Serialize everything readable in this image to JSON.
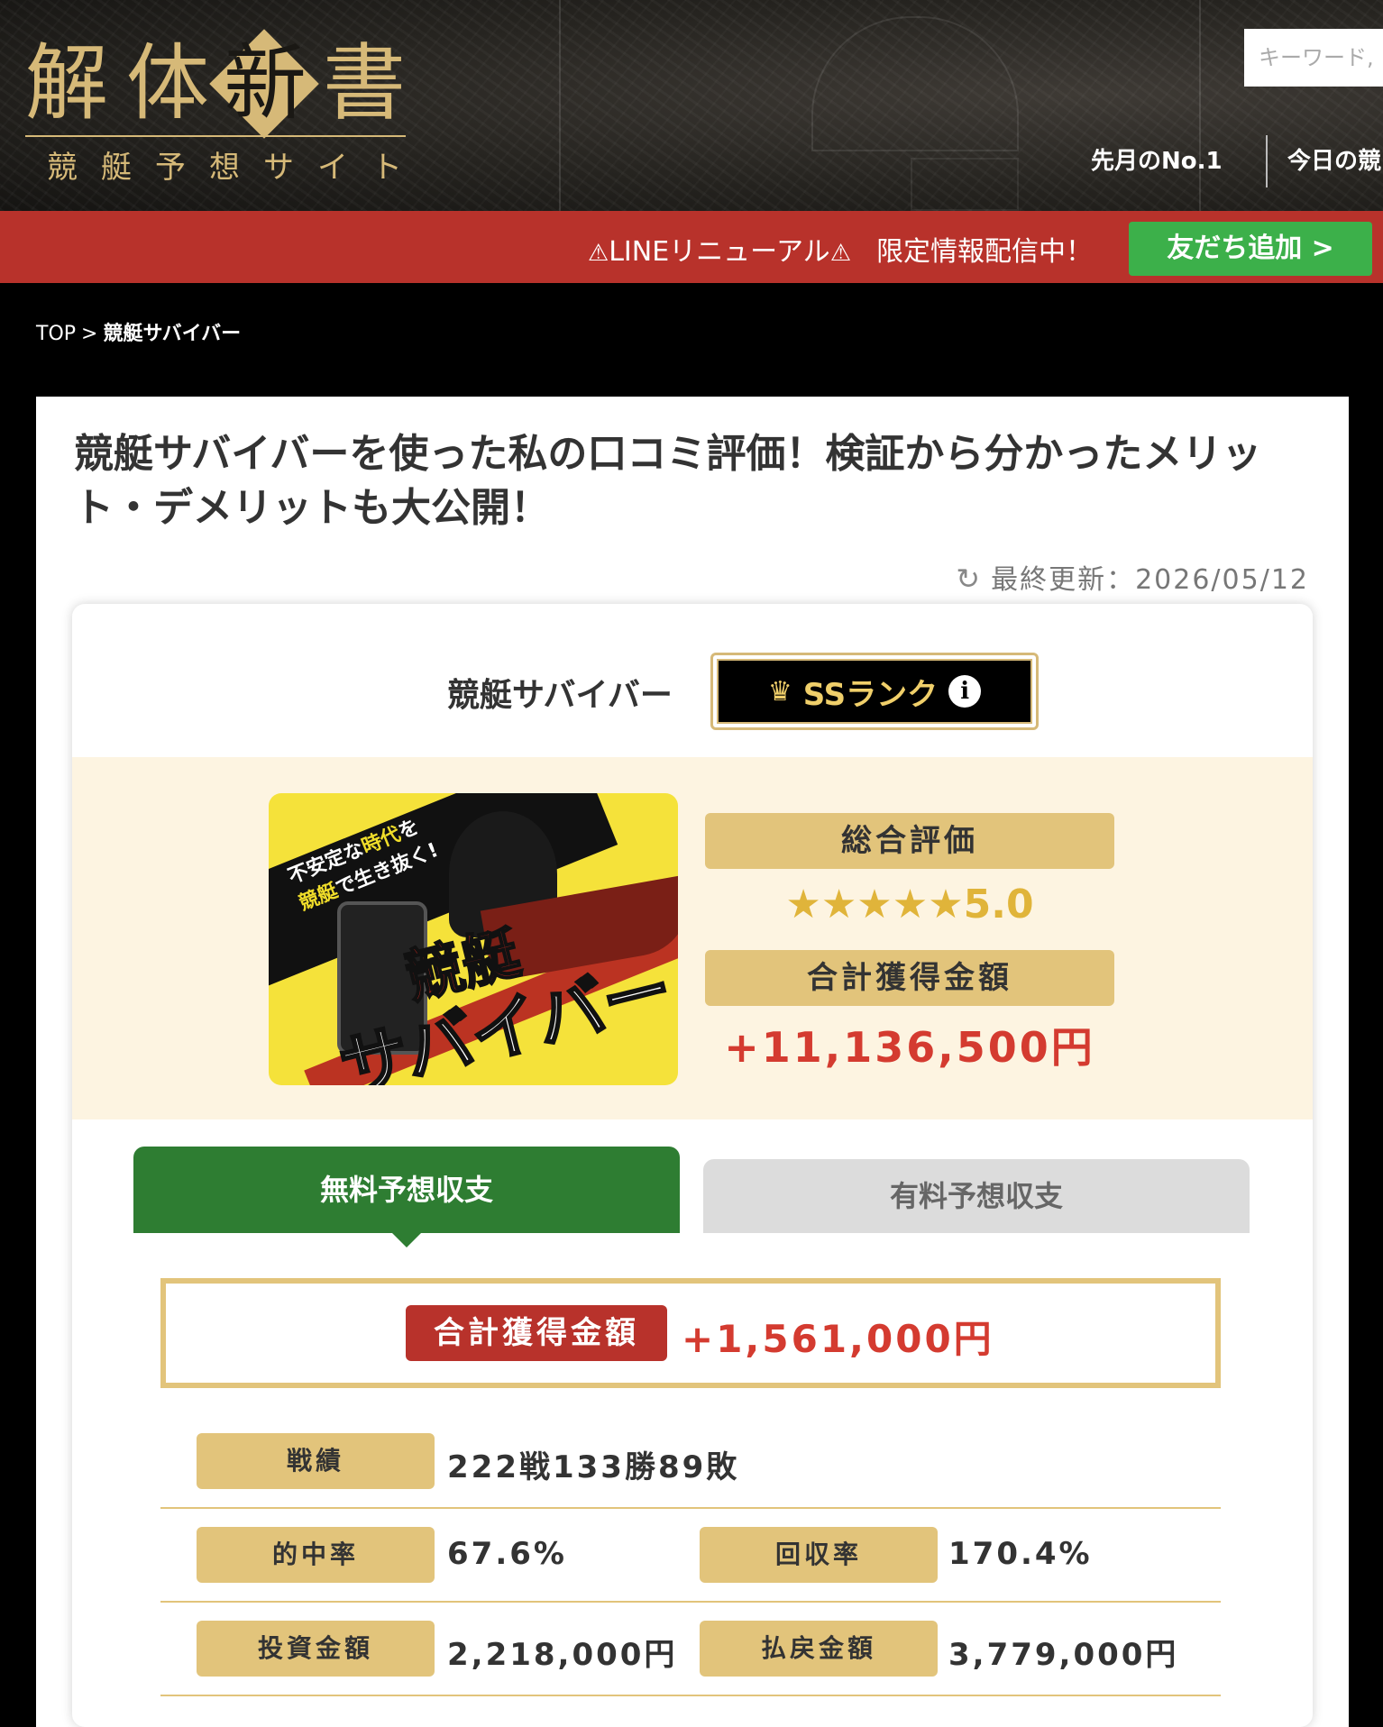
{
  "header": {
    "logo": {
      "title_chars": [
        "解",
        "体",
        "新",
        "書"
      ],
      "subtitle": "競艇予想サイト"
    },
    "search_placeholder": "キーワード,",
    "nav": [
      "先月のNo.1",
      "今日の競"
    ]
  },
  "banner": {
    "warn_icon": "⚠",
    "line_text": "LINEリニューアル",
    "promo_text": "限定情報配信中！",
    "button_label": "友だち追加 >"
  },
  "breadcrumb": {
    "home": "TOP",
    "separator": ">",
    "current": "競艇サバイバー"
  },
  "article": {
    "title": "競艇サバイバーを使った私の口コミ評価！検証から分かったメリット・デメリットも大公開！",
    "refresh_icon": "↻",
    "updated": "最終更新：2026/05/12"
  },
  "rating": {
    "site_name": "競艇サバイバー",
    "crown_icon": "♛",
    "rank": "SSランク",
    "info_icon": "i",
    "thumbnail": {
      "tagline_a": "不安定な",
      "tagline_b": "時代",
      "tagline_c": "を",
      "tagline_d": "競艇",
      "tagline_e": "で生き抜く!",
      "name_top": "競艇",
      "name_bottom": "サバイバー"
    },
    "overall_label": "総合評価",
    "stars": "★★★★★",
    "score": "5.0",
    "total_label": "合計獲得金額",
    "total_amount": "+11,136,500円"
  },
  "tabs": {
    "free": "無料予想収支",
    "paid": "有料予想収支"
  },
  "free_stats": {
    "total_label": "合計獲得金額",
    "total_value": "+1,561,000円",
    "record_label": "戦績",
    "record_value": "222戦133勝89敗",
    "hit_rate_label": "的中率",
    "hit_rate_value": "67.6%",
    "recovery_label": "回収率",
    "recovery_value": "170.4%",
    "invest_label": "投資金額",
    "invest_value": "2,218,000円",
    "payout_label": "払戻金額",
    "payout_value": "3,779,000円"
  }
}
